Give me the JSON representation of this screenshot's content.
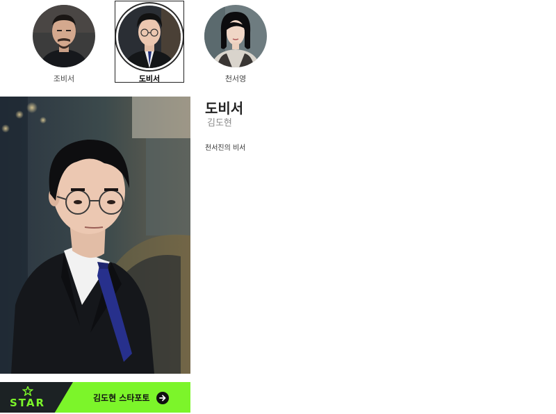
{
  "characters": [
    {
      "name": "조비서",
      "selected": false
    },
    {
      "name": "도비서",
      "selected": true
    },
    {
      "name": "천서영",
      "selected": false
    }
  ],
  "detail": {
    "role": "도비서",
    "actor": "김도현",
    "description": "천서진의 비서"
  },
  "star_banner": {
    "brand": "STAR",
    "link_label": "김도현 스타포토",
    "icon": "arrow-right-circle-icon",
    "accent_color": "#7cf52a",
    "dark_color": "#1c2224"
  }
}
